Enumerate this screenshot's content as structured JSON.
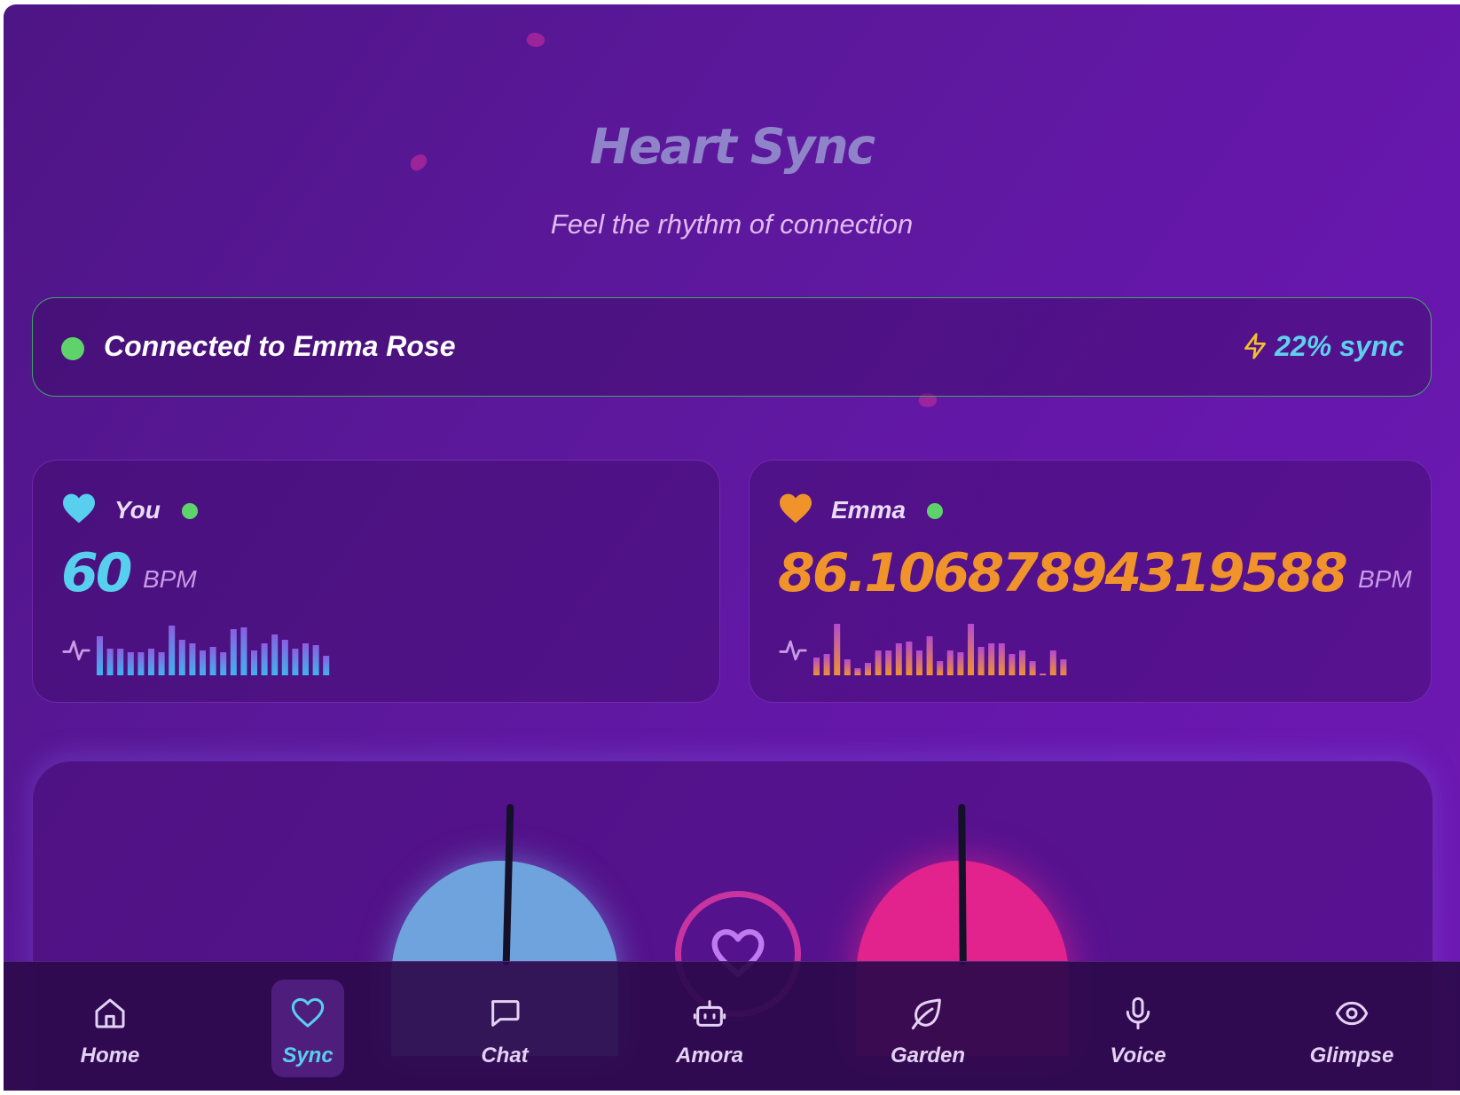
{
  "header": {
    "title": "Heart Sync",
    "subtitle": "Feel the rhythm of connection"
  },
  "connection": {
    "status_text": "Connected to Emma Rose",
    "sync_text": "22% sync",
    "status_icon": "online-dot",
    "sync_icon": "bolt-icon"
  },
  "partners": [
    {
      "name": "You",
      "bpm": "60",
      "unit": "BPM",
      "color": "#58cfee",
      "icon": "heart-icon"
    },
    {
      "name": "Emma",
      "bpm": "86.10687894319588",
      "unit": "BPM",
      "color": "#f0932b",
      "icon": "heart-icon"
    }
  ],
  "colors": {
    "accent_cyan": "#58cfee",
    "accent_orange": "#f0932b",
    "accent_pink": "#e6268c",
    "online_green": "#5ed36b"
  },
  "nav": {
    "items": [
      {
        "label": "Home",
        "icon": "home-icon"
      },
      {
        "label": "Sync",
        "icon": "heart-icon",
        "active": true
      },
      {
        "label": "Chat",
        "icon": "chat-icon"
      },
      {
        "label": "Amora",
        "icon": "bot-icon"
      },
      {
        "label": "Garden",
        "icon": "leaf-icon"
      },
      {
        "label": "Voice",
        "icon": "mic-icon"
      },
      {
        "label": "Glimpse",
        "icon": "eye-icon"
      }
    ]
  }
}
